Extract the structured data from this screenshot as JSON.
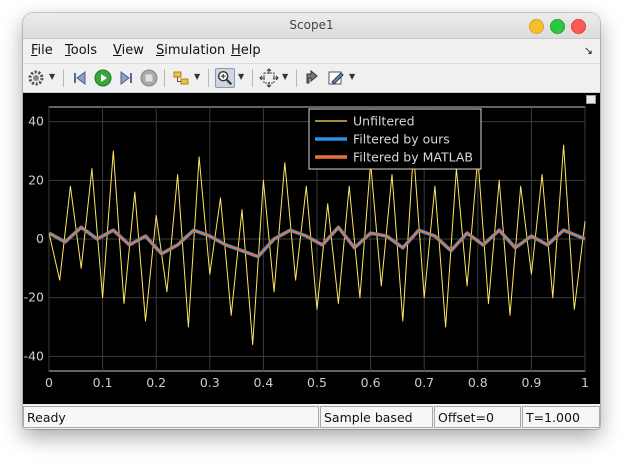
{
  "window": {
    "title": "Scope1"
  },
  "menu": [
    {
      "first": "F",
      "rest": "ile"
    },
    {
      "first": "T",
      "rest": "ools"
    },
    {
      "first": "V",
      "rest": "iew"
    },
    {
      "first": "S",
      "rest": "imulation"
    },
    {
      "first": "H",
      "rest": "elp"
    }
  ],
  "toolbar": {
    "icons": [
      "gear-icon",
      "step-back-icon",
      "run-icon",
      "step-forward-icon",
      "stop-icon",
      "highlight-block-icon",
      "zoom-icon",
      "autoscale-icon",
      "restore-icon",
      "style-icon"
    ]
  },
  "status": {
    "ready": "Ready",
    "mode": "Sample based",
    "offset": "Offset=0",
    "time": "T=1.000"
  },
  "colors": {
    "unfiltered": "#ffe75e",
    "filtered_ours": "#2f8fe6",
    "filtered_matlab": "#e8733a",
    "grid": "#3c3c3c",
    "axes": "#c8c8c8"
  },
  "chart_data": {
    "type": "line",
    "xlim": [
      0,
      1
    ],
    "ylim": [
      -45,
      45
    ],
    "xticks": [
      "0",
      "0.1",
      "0.2",
      "0.3",
      "0.4",
      "0.5",
      "0.6",
      "0.7",
      "0.8",
      "0.9",
      "1"
    ],
    "yticks": [
      "40",
      "20",
      "0",
      "-20",
      "-40"
    ],
    "grid": true,
    "legend_position": "top-right",
    "series": [
      {
        "name": "Unfiltered",
        "x": [
          0,
          0.02,
          0.04,
          0.06,
          0.08,
          0.1,
          0.12,
          0.14,
          0.16,
          0.18,
          0.2,
          0.22,
          0.24,
          0.26,
          0.28,
          0.3,
          0.32,
          0.34,
          0.36,
          0.38,
          0.4,
          0.42,
          0.44,
          0.46,
          0.48,
          0.5,
          0.52,
          0.54,
          0.56,
          0.58,
          0.6,
          0.62,
          0.64,
          0.66,
          0.68,
          0.7,
          0.72,
          0.74,
          0.76,
          0.78,
          0.8,
          0.82,
          0.84,
          0.86,
          0.88,
          0.9,
          0.92,
          0.94,
          0.96,
          0.98,
          1
        ],
        "values": [
          2,
          -14,
          18,
          -10,
          24,
          -20,
          30,
          -22,
          16,
          -28,
          8,
          -18,
          22,
          -30,
          28,
          -12,
          14,
          -26,
          10,
          -36,
          20,
          -18,
          26,
          -14,
          18,
          -24,
          12,
          -22,
          18,
          -20,
          26,
          -16,
          22,
          -28,
          30,
          -20,
          18,
          -30,
          24,
          -16,
          28,
          -22,
          20,
          -26,
          18,
          -12,
          22,
          -20,
          32,
          -24,
          6
        ]
      },
      {
        "name": "Filtered by ours",
        "x": [
          0,
          0.03,
          0.06,
          0.09,
          0.12,
          0.15,
          0.18,
          0.21,
          0.24,
          0.27,
          0.3,
          0.33,
          0.36,
          0.39,
          0.42,
          0.45,
          0.48,
          0.51,
          0.54,
          0.57,
          0.6,
          0.63,
          0.66,
          0.69,
          0.72,
          0.75,
          0.78,
          0.81,
          0.84,
          0.87,
          0.9,
          0.93,
          0.96,
          1
        ],
        "values": [
          2,
          -1,
          4,
          0,
          3,
          -2,
          1,
          -5,
          -2,
          3,
          1,
          -2,
          -4,
          -6,
          0,
          3,
          1,
          -2,
          4,
          -3,
          2,
          1,
          -3,
          3,
          1,
          -4,
          2,
          -2,
          3,
          -3,
          1,
          -2,
          3,
          0
        ]
      },
      {
        "name": "Filtered by MATLAB",
        "x": [
          0,
          0.03,
          0.06,
          0.09,
          0.12,
          0.15,
          0.18,
          0.21,
          0.24,
          0.27,
          0.3,
          0.33,
          0.36,
          0.39,
          0.42,
          0.45,
          0.48,
          0.51,
          0.54,
          0.57,
          0.6,
          0.63,
          0.66,
          0.69,
          0.72,
          0.75,
          0.78,
          0.81,
          0.84,
          0.87,
          0.9,
          0.93,
          0.96,
          1
        ],
        "values": [
          2,
          -1,
          4,
          0,
          3,
          -2,
          1,
          -5,
          -2,
          3,
          1,
          -2,
          -4,
          -6,
          0,
          3,
          1,
          -2,
          4,
          -3,
          2,
          1,
          -3,
          3,
          1,
          -4,
          2,
          -2,
          3,
          -3,
          1,
          -2,
          3,
          0
        ]
      }
    ]
  }
}
